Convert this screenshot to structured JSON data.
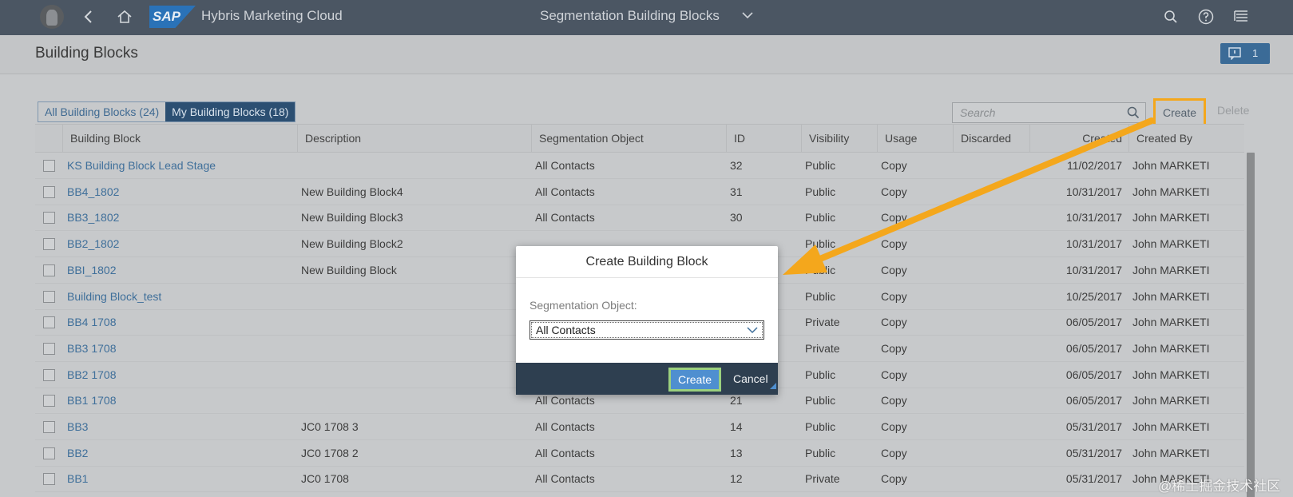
{
  "shell": {
    "app_name": "Hybris Marketing Cloud",
    "logo_text": "SAP",
    "center_title": "Segmentation Building Blocks"
  },
  "header": {
    "title": "Building Blocks",
    "messages_count": "1"
  },
  "toolbar": {
    "tabs": [
      {
        "label": "All Building Blocks (24)",
        "active": false
      },
      {
        "label": "My Building Blocks (18)",
        "active": true
      }
    ],
    "search_placeholder": "Search",
    "create_label": "Create",
    "delete_label": "Delete"
  },
  "table": {
    "columns": [
      "Building Block",
      "Description",
      "Segmentation Object",
      "ID",
      "Visibility",
      "Usage",
      "Discarded",
      "Created",
      "Created By"
    ],
    "rows": [
      {
        "name": "KS Building Block Lead Stage",
        "description": "",
        "object": "All Contacts",
        "id": "32",
        "visibility": "Public",
        "usage": "Copy",
        "discarded": "",
        "created": "11/02/2017",
        "created_by": "John MARKETI"
      },
      {
        "name": "BB4_1802",
        "description": "New Building Block4",
        "object": "All Contacts",
        "id": "31",
        "visibility": "Public",
        "usage": "Copy",
        "discarded": "",
        "created": "10/31/2017",
        "created_by": "John MARKETI"
      },
      {
        "name": "BB3_1802",
        "description": "New Building Block3",
        "object": "All Contacts",
        "id": "30",
        "visibility": "Public",
        "usage": "Copy",
        "discarded": "",
        "created": "10/31/2017",
        "created_by": "John MARKETI"
      },
      {
        "name": "BB2_1802",
        "description": "New Building Block2",
        "object": "",
        "id": "",
        "visibility": "Public",
        "usage": "Copy",
        "discarded": "",
        "created": "10/31/2017",
        "created_by": "John MARKETI"
      },
      {
        "name": "BBI_1802",
        "description": "New Building Block",
        "object": "",
        "id": "",
        "visibility": "Public",
        "usage": "Copy",
        "discarded": "",
        "created": "10/31/2017",
        "created_by": "John MARKETI"
      },
      {
        "name": "Building Block_test",
        "description": "",
        "object": "",
        "id": "",
        "visibility": "Public",
        "usage": "Copy",
        "discarded": "",
        "created": "10/25/2017",
        "created_by": "John MARKETI"
      },
      {
        "name": "BB4 1708",
        "description": "",
        "object": "",
        "id": "",
        "visibility": "Private",
        "usage": "Copy",
        "discarded": "",
        "created": "06/05/2017",
        "created_by": "John MARKETI"
      },
      {
        "name": "BB3 1708",
        "description": "",
        "object": "",
        "id": "",
        "visibility": "Private",
        "usage": "Copy",
        "discarded": "",
        "created": "06/05/2017",
        "created_by": "John MARKETI"
      },
      {
        "name": "BB2 1708",
        "description": "",
        "object": "",
        "id": "",
        "visibility": "Public",
        "usage": "Copy",
        "discarded": "",
        "created": "06/05/2017",
        "created_by": "John MARKETI"
      },
      {
        "name": "BB1 1708",
        "description": "",
        "object": "All Contacts",
        "id": "21",
        "visibility": "Public",
        "usage": "Copy",
        "discarded": "",
        "created": "06/05/2017",
        "created_by": "John MARKETI"
      },
      {
        "name": "BB3",
        "description": "JC0 1708 3",
        "object": "All Contacts",
        "id": "14",
        "visibility": "Public",
        "usage": "Copy",
        "discarded": "",
        "created": "05/31/2017",
        "created_by": "John MARKETI"
      },
      {
        "name": "BB2",
        "description": "JC0 1708 2",
        "object": "All Contacts",
        "id": "13",
        "visibility": "Public",
        "usage": "Copy",
        "discarded": "",
        "created": "05/31/2017",
        "created_by": "John MARKETI"
      },
      {
        "name": "BB1",
        "description": "JC0 1708",
        "object": "All Contacts",
        "id": "12",
        "visibility": "Private",
        "usage": "Copy",
        "discarded": "",
        "created": "05/31/2017",
        "created_by": "John MARKETI"
      }
    ]
  },
  "dialog": {
    "title": "Create Building Block",
    "field_label": "Segmentation Object:",
    "field_value": "All Contacts",
    "create_label": "Create",
    "cancel_label": "Cancel"
  },
  "watermark": "@稀土掘金技术社区",
  "colors": {
    "annotation": "#f4a71c",
    "shell": "#4b5663",
    "link": "#3f6f9a",
    "dialog_footer": "#2e3f50",
    "primary_button": "#4f8fd0"
  }
}
